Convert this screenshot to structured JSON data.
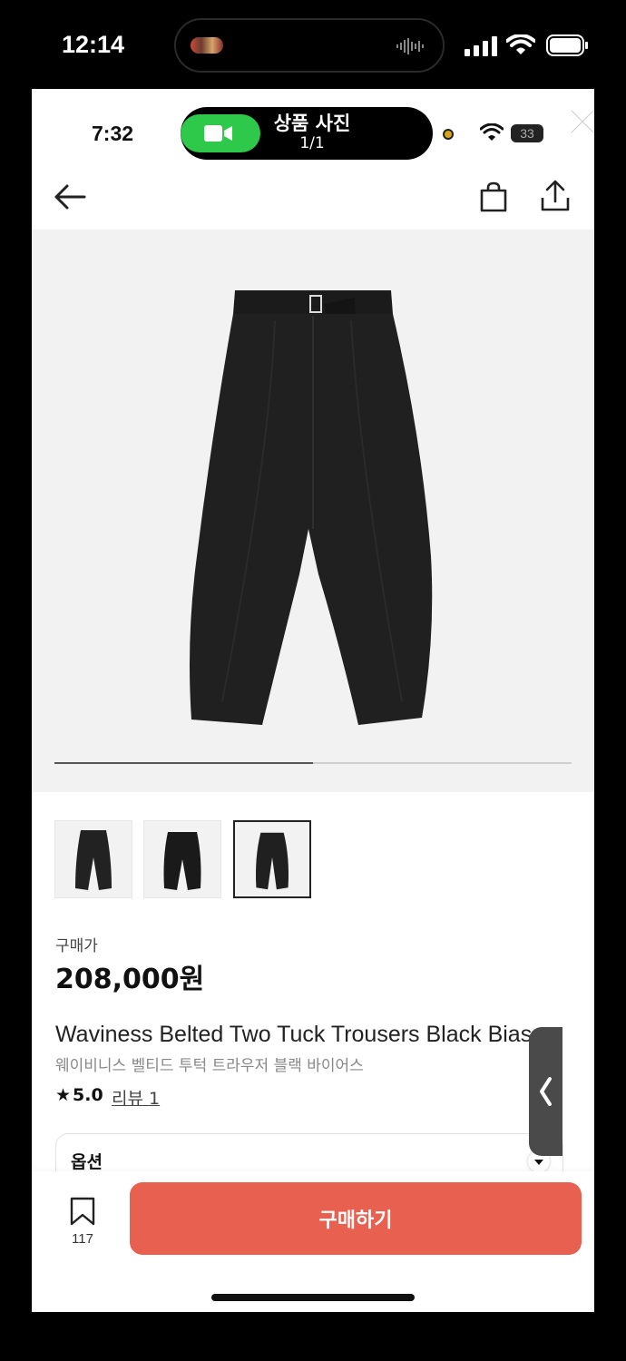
{
  "outer_status": {
    "time": "12:14"
  },
  "inner_status": {
    "time": "7:32",
    "battery": "33"
  },
  "viewer": {
    "title": "상품 사진",
    "count": "1/1"
  },
  "gallery": {
    "progress": 0.5,
    "thumbnail_count": 3,
    "selected_thumbnail": 3
  },
  "product": {
    "price_label": "구매가",
    "price": "208,000원",
    "name_en": "Waviness Belted Two Tuck Trousers Black Bias",
    "name_ko": "웨이비니스 벨티드 투턱 트라우저 블랙 바이어스",
    "rating": "5.0",
    "review_link": "리뷰 1"
  },
  "options": {
    "label": "옵션"
  },
  "bottom": {
    "bookmark_count": "117",
    "buy_label": "구매하기"
  },
  "colors": {
    "buy_button": "#e8604f",
    "facetime_green": "#2ec84b"
  },
  "icons": [
    "back-arrow-icon",
    "shopping-bag-icon",
    "share-icon",
    "close-icon",
    "bookmark-icon",
    "chevron-down-icon",
    "chevron-left-icon",
    "star-icon"
  ]
}
